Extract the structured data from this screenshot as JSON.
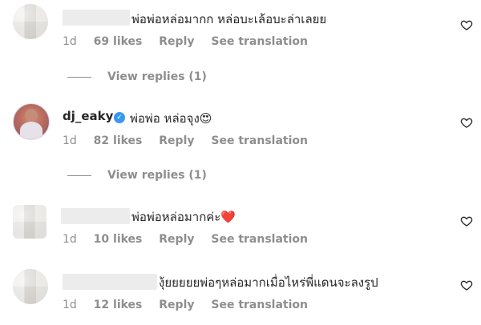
{
  "comments": [
    {
      "text": "พ่อพ่อหล่อมากก หล่อบะเล้อบะล่าเลยย",
      "time": "1d",
      "likes": "69 likes",
      "reply": "Reply",
      "translate": "See translation",
      "view_replies": "View replies (1)"
    },
    {
      "username": "dj_eaky",
      "text": "พ่อพ่อ หล่อจุง😍",
      "time": "1d",
      "likes": "82 likes",
      "reply": "Reply",
      "translate": "See translation",
      "view_replies": "View replies (1)"
    },
    {
      "text": "พ่อพ่อหล่อมากค่ะ❤️",
      "time": "1d",
      "likes": "10 likes",
      "reply": "Reply",
      "translate": "See translation"
    },
    {
      "text": "งุ้ยยยยยพ่อๆหล่อมากเมื่อไหร่พี่แดนจะลงรูป",
      "time": "1d",
      "likes": "12 likes",
      "reply": "Reply",
      "translate": "See translation"
    }
  ],
  "icons": {
    "like": "heart-outline-icon",
    "verified": "verified-badge-icon"
  },
  "colors": {
    "text": "#262626",
    "meta": "#8e8e8e",
    "verified": "#3897f0"
  }
}
